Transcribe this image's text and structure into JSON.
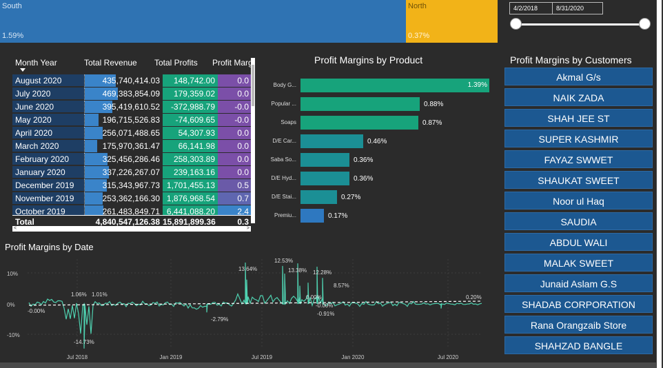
{
  "treemap": {
    "south": {
      "name": "South",
      "value": "1.59%"
    },
    "north": {
      "name": "North",
      "value": "0.37%"
    }
  },
  "slicer": {
    "start": "4/2/2018",
    "end": "8/31/2020"
  },
  "matrix": {
    "headers": [
      "Month Year",
      "Total Revenue",
      "Total Profits",
      "Profit Margins"
    ],
    "rows": [
      {
        "month": "August 2020",
        "revenue": "435,740,414.03",
        "profits": "148,742.00",
        "margin": "0.0",
        "rev_pct": 0.93,
        "margin_color": "#7b4fa8"
      },
      {
        "month": "July 2020",
        "revenue": "469,383,854.09",
        "profits": "179,359.02",
        "margin": "0.0",
        "rev_pct": 1.0,
        "margin_color": "#7b4fa8"
      },
      {
        "month": "June 2020",
        "revenue": "395,419,610.52",
        "profits": "-372,988.79",
        "margin": "-0.0",
        "rev_pct": 0.84,
        "margin_color": "#7b4fa8"
      },
      {
        "month": "May 2020",
        "revenue": "196,715,526.83",
        "profits": "-74,609.65",
        "margin": "-0.0",
        "rev_pct": 0.42,
        "margin_color": "#7b4fa8"
      },
      {
        "month": "April 2020",
        "revenue": "256,071,488.65",
        "profits": "54,307.93",
        "margin": "0.0",
        "rev_pct": 0.55,
        "margin_color": "#7b4fa8"
      },
      {
        "month": "March 2020",
        "revenue": "175,970,361.47",
        "profits": "66,141.98",
        "margin": "0.0",
        "rev_pct": 0.37,
        "margin_color": "#7b4fa8"
      },
      {
        "month": "February 2020",
        "revenue": "325,456,286.46",
        "profits": "258,303.89",
        "margin": "0.0",
        "rev_pct": 0.69,
        "margin_color": "#7b4fa8"
      },
      {
        "month": "January 2020",
        "revenue": "337,226,267.07",
        "profits": "239,163.16",
        "margin": "0.0",
        "rev_pct": 0.72,
        "margin_color": "#7b4fa8"
      },
      {
        "month": "December 2019",
        "revenue": "315,343,967.73",
        "profits": "1,701,455.13",
        "margin": "0.5",
        "rev_pct": 0.67,
        "margin_color": "#6a5aa8"
      },
      {
        "month": "November 2019",
        "revenue": "253,362,166.30",
        "profits": "1,876,968.54",
        "margin": "0.7",
        "rev_pct": 0.54,
        "margin_color": "#5f66b0"
      },
      {
        "month": "October 2019",
        "revenue": "261,483,849.71",
        "profits": "6,441,088.20",
        "margin": "2.4",
        "rev_pct": 0.56,
        "margin_color": "#3a84c9"
      }
    ],
    "total": {
      "label": "Total",
      "revenue": "4,840,547,126.38",
      "profits": "15,891,899.36",
      "margin": "0.3"
    }
  },
  "product_chart": {
    "title": "Profit Margins by Product",
    "bars": [
      {
        "category": "Body G...",
        "value": 1.39,
        "label": "1.39%",
        "color": "#17a37b"
      },
      {
        "category": "Popular ...",
        "value": 0.88,
        "label": "0.88%",
        "color": "#17a37b"
      },
      {
        "category": "Soaps",
        "value": 0.87,
        "label": "0.87%",
        "color": "#17a37b"
      },
      {
        "category": "D/E Car...",
        "value": 0.46,
        "label": "0.46%",
        "color": "#1b8f95"
      },
      {
        "category": "Saba So...",
        "value": 0.36,
        "label": "0.36%",
        "color": "#1b8f95"
      },
      {
        "category": "D/E Hyd...",
        "value": 0.36,
        "label": "0.36%",
        "color": "#1b8f95"
      },
      {
        "category": "D/E Stai...",
        "value": 0.27,
        "label": "0.27%",
        "color": "#1b8f95"
      },
      {
        "category": "Premiu...",
        "value": 0.17,
        "label": "0.17%",
        "color": "#2e78c0"
      }
    ],
    "max": 1.39
  },
  "customers": {
    "title": "Profit Margins by Customers",
    "items": [
      "Akmal G/s",
      "NAIK ZADA",
      "SHAH JEE ST",
      "SUPER KASHMIR",
      "FAYAZ SWWET",
      "SHAUKAT SWEET",
      "Noor ul Haq",
      "SAUDIA",
      "ABDUL WALI",
      "MALAK SWEET",
      "Junaid Aslam G.S",
      "SHADAB CORPORATION",
      "Rana Orangzaib Store",
      "SHAHZAD BANGLE"
    ]
  },
  "date_chart": {
    "title": "Profit Margins by Date",
    "y_ticks": [
      "10%",
      "0%",
      "-10%"
    ],
    "x_ticks": [
      "Jul 2018",
      "Jan 2019",
      "Jul 2019",
      "Jan 2020",
      "Jul 2020"
    ],
    "annotations": [
      "-0.00%",
      "1.06%",
      "1.01%",
      "-14.73%",
      "-2.79%",
      "13.64%",
      "12.53%",
      "13.38%",
      "12.28%",
      "8.57%",
      "0.00%",
      "-0.00%",
      "-0.91%",
      "0.20%"
    ],
    "line_color": "#4fd1b0"
  }
}
